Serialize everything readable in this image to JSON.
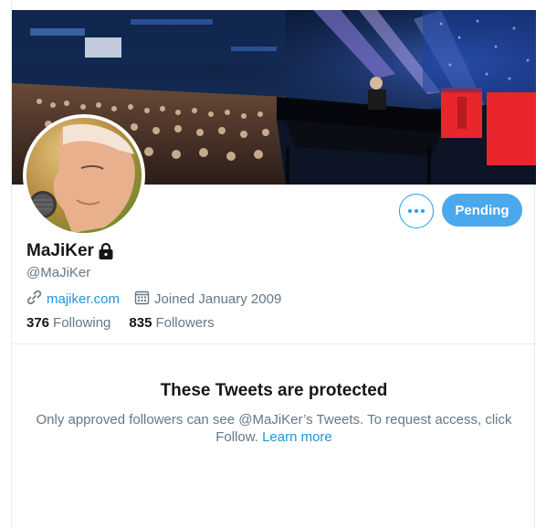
{
  "profile": {
    "display_name": "MaJiKer",
    "handle": "@MaJiKer",
    "website": "majiker.com",
    "joined": "Joined January 2009",
    "following_count": "376",
    "following_label": "Following",
    "followers_count": "835",
    "followers_label": "Followers",
    "is_protected": true
  },
  "actions": {
    "follow_state_label": "Pending"
  },
  "protected_notice": {
    "title": "These Tweets are protected",
    "description": "Only approved followers can see @MaJiKer’s Tweets. To request access, click Follow.",
    "learn_more": "Learn more"
  },
  "colors": {
    "accent": "#1da1f2",
    "pending_button": "#4aa8ec",
    "link": "#1b95e0",
    "secondary_text": "#657786"
  },
  "icons": [
    "more-icon",
    "lock-icon",
    "link-icon",
    "calendar-icon"
  ]
}
